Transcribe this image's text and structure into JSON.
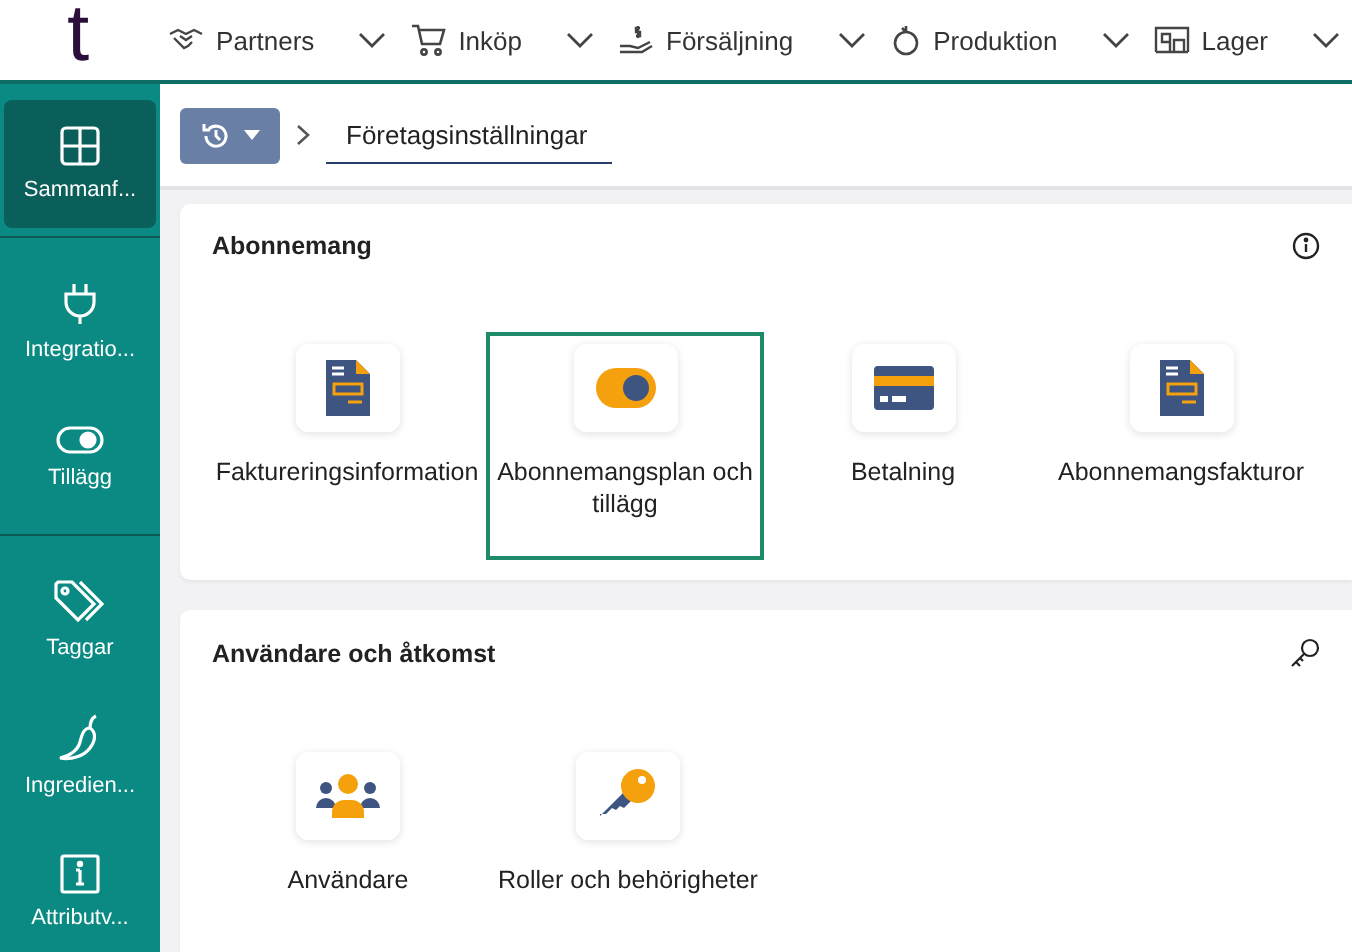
{
  "logo": "t",
  "nav": [
    {
      "label": "Partners"
    },
    {
      "label": "Inköp"
    },
    {
      "label": "Försäljning"
    },
    {
      "label": "Produktion"
    },
    {
      "label": "Lager"
    }
  ],
  "sidebar": {
    "groups": [
      {
        "items": [
          {
            "label": "Sammanf...",
            "selected": true
          }
        ]
      },
      {
        "items": [
          {
            "label": "Integratio...",
            "selected": false
          },
          {
            "label": "Tillägg",
            "selected": false
          }
        ]
      },
      {
        "items": [
          {
            "label": "Taggar",
            "selected": false
          },
          {
            "label": "Ingredien...",
            "selected": false
          },
          {
            "label": "Attributv...",
            "selected": false
          }
        ]
      }
    ]
  },
  "breadcrumb": {
    "current": "Företagsinställningar"
  },
  "sections": [
    {
      "title": "Abonnemang",
      "tiles": [
        {
          "label": "Faktureringsinformation",
          "selected": false
        },
        {
          "label": "Abonnemangsplan och tillägg",
          "selected": true
        },
        {
          "label": "Betalning",
          "selected": false
        },
        {
          "label": "Abonnemangsfakturor",
          "selected": false
        }
      ]
    },
    {
      "title": "Användare och åtkomst",
      "tiles": [
        {
          "label": "Användare",
          "selected": false
        },
        {
          "label": "Roller och behörigheter",
          "selected": false
        }
      ]
    }
  ]
}
